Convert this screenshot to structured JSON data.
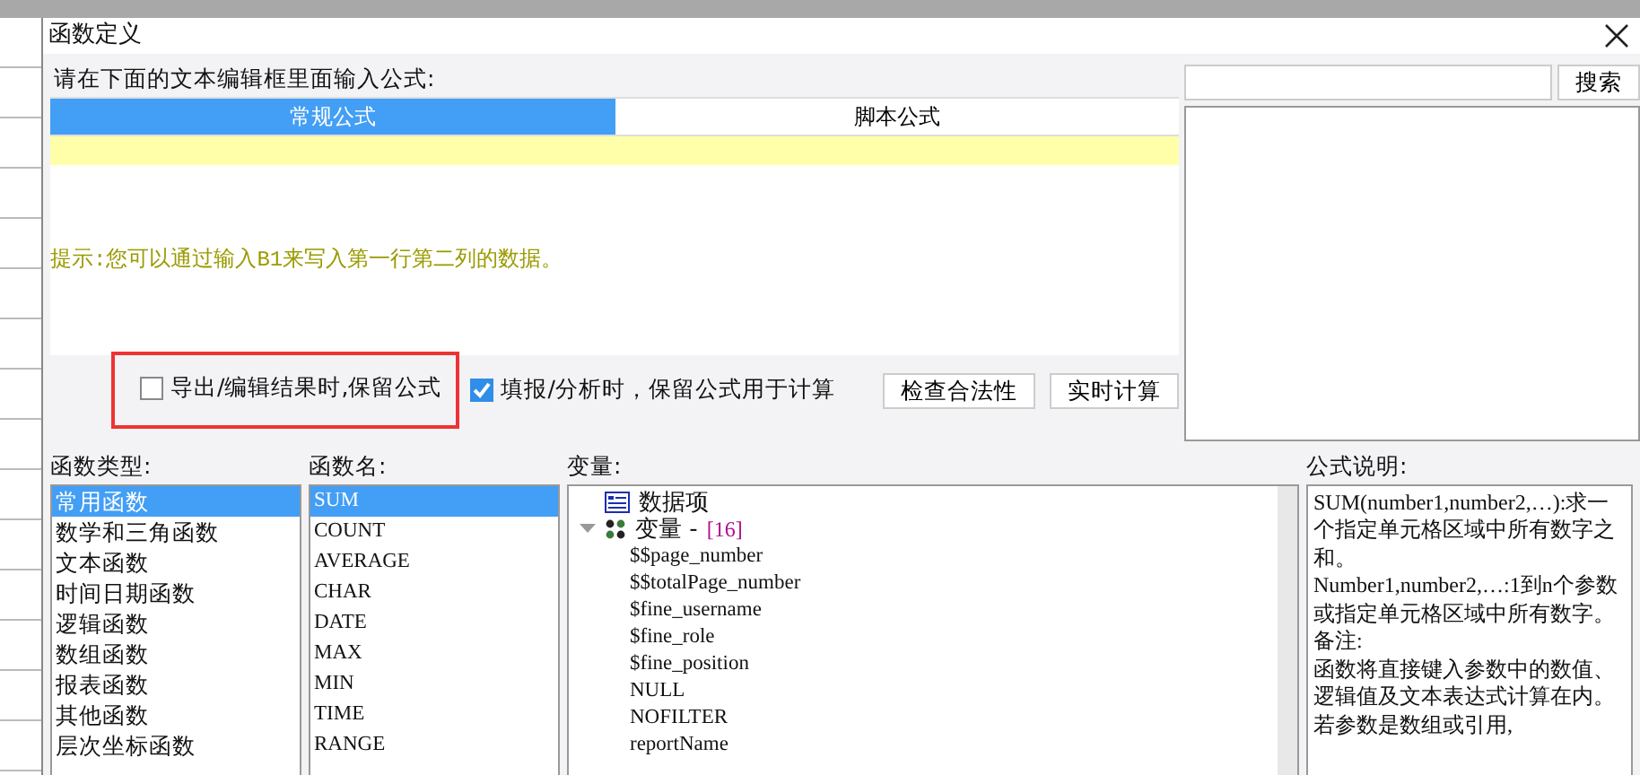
{
  "window": {
    "title": "函数定义"
  },
  "editor": {
    "prompt": "请在下面的文本编辑框里面输入公式:",
    "tabs": [
      {
        "label": "常规公式",
        "selected": true
      },
      {
        "label": "脚本公式",
        "selected": false
      }
    ],
    "hint": "提示:您可以通过输入B1来写入第一行第二列的数据。"
  },
  "options": [
    {
      "label": "导出/编辑结果时,保留公式",
      "checked": false,
      "highlighted": true
    },
    {
      "label": "填报/分析时，保留公式用于计算",
      "checked": true,
      "highlighted": false
    }
  ],
  "buttons": [
    "检查合法性",
    "实时计算"
  ],
  "search": {
    "button": "搜索"
  },
  "function_types": {
    "label": "函数类型:",
    "items": [
      {
        "label": "常用函数",
        "selected": true
      },
      {
        "label": "数学和三角函数",
        "selected": false
      },
      {
        "label": "文本函数",
        "selected": false
      },
      {
        "label": "时间日期函数",
        "selected": false
      },
      {
        "label": "逻辑函数",
        "selected": false
      },
      {
        "label": "数组函数",
        "selected": false
      },
      {
        "label": "报表函数",
        "selected": false
      },
      {
        "label": "其他函数",
        "selected": false
      },
      {
        "label": "层次坐标函数",
        "selected": false
      }
    ]
  },
  "function_names": {
    "label": "函数名:",
    "items": [
      {
        "label": "SUM",
        "selected": true
      },
      {
        "label": "COUNT",
        "selected": false
      },
      {
        "label": "AVERAGE",
        "selected": false
      },
      {
        "label": "CHAR",
        "selected": false
      },
      {
        "label": "DATE",
        "selected": false
      },
      {
        "label": "MAX",
        "selected": false
      },
      {
        "label": "MIN",
        "selected": false
      },
      {
        "label": "TIME",
        "selected": false
      },
      {
        "label": "RANGE",
        "selected": false
      }
    ]
  },
  "variables": {
    "label": "变量:",
    "tree": [
      {
        "kind": "table",
        "label": "数据项"
      },
      {
        "kind": "group",
        "label": "变量 -",
        "count": "[16]",
        "expanded": true,
        "children": [
          {
            "label": "$$page_number"
          },
          {
            "label": "$$totalPage_number"
          },
          {
            "label": "$fine_username"
          },
          {
            "label": "$fine_role"
          },
          {
            "label": "$fine_position"
          },
          {
            "label": "NULL"
          },
          {
            "label": "NOFILTER"
          },
          {
            "label": "reportName"
          }
        ]
      }
    ]
  },
  "description": {
    "label": "公式说明:",
    "paragraphs": [
      "SUM(number1,number2,…):求一个指定单元格区域中所有数字之和。",
      "Number1,number2,…:1到n个参数或指定单元格区域中所有数字。",
      "备注:",
      "函数将直接键入参数中的数值、逻辑值及文本表达式计算在内。若参数是数组或引用,"
    ]
  }
}
